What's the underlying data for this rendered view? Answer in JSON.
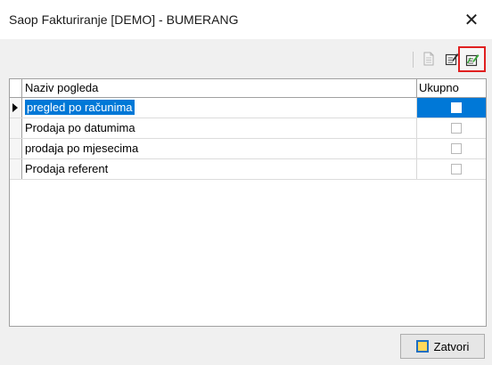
{
  "window": {
    "title": "Saop Fakturiranje [DEMO] - BUMERANG",
    "close_glyph": "✕"
  },
  "toolbar": {
    "buttons": [
      {
        "name": "document-icon",
        "enabled": false
      },
      {
        "name": "edit-icon",
        "enabled": true
      },
      {
        "name": "edit-settings-icon",
        "enabled": true,
        "highlighted": true
      }
    ]
  },
  "grid": {
    "columns": [
      "Naziv pogleda",
      "Ukupno"
    ],
    "rows": [
      {
        "name": "pregled po računima",
        "ukupno": false,
        "selected": true
      },
      {
        "name": "Prodaja po datumima",
        "ukupno": false,
        "selected": false
      },
      {
        "name": "prodaja po mjesecima",
        "ukupno": false,
        "selected": false
      },
      {
        "name": "Prodaja referent",
        "ukupno": false,
        "selected": false
      }
    ]
  },
  "footer": {
    "close_label": "Zatvori"
  },
  "colors": {
    "selection": "#0078d7",
    "highlight_border": "#e02020"
  }
}
